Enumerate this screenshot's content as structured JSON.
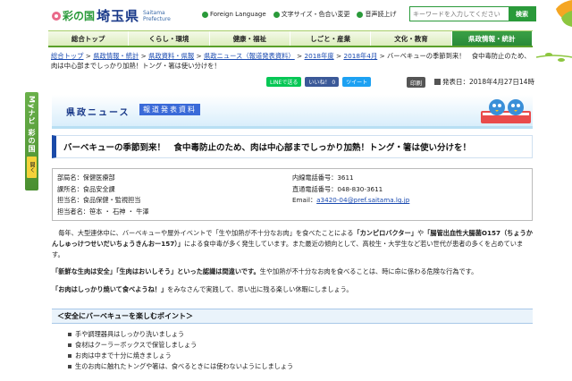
{
  "header": {
    "logo_prefix": "彩の国",
    "logo_main": "埼玉県",
    "logo_sub_1": "Saitama",
    "logo_sub_2": "Prefecture",
    "foreign_language": "Foreign Language",
    "text_size": "文字サイズ・色合い変更",
    "voice": "音声読上げ",
    "search_placeholder": "キーワードを入力してください",
    "search_button": "検索"
  },
  "nav": [
    {
      "label": "総合トップ",
      "active": false
    },
    {
      "label": "くらし・環境",
      "active": false
    },
    {
      "label": "健康・福祉",
      "active": false
    },
    {
      "label": "しごと・産業",
      "active": false
    },
    {
      "label": "文化・教育",
      "active": false
    },
    {
      "label": "県政情報・統計",
      "active": true
    }
  ],
  "side_tab": {
    "label": "Myナビ 彩の国",
    "open_button": "開く"
  },
  "breadcrumb": {
    "links": [
      "総合トップ",
      "県政情報・統計",
      "県政資料・県報",
      "県政ニュース（報道発表資料）",
      "2018年度",
      "2018年4月"
    ],
    "separator": " > ",
    "current": "バーベキューの季節到来！　食中毒防止のため、肉は中心部までしっかり加熱！トング・箸は使い分けを！"
  },
  "share": {
    "line": "LINEで送る",
    "facebook": "いいね！ 0",
    "twitter": "ツイート",
    "print": "印刷",
    "date": "発表日：2018年4月27日14時"
  },
  "banner": {
    "title": "県政ニュース",
    "tag": "報道発表資料"
  },
  "headline": "バーベキューの季節到来！　食中毒防止のため、肉は中心部までしっかり加熱！トング・箸は使い分けを！",
  "info": {
    "dept": "部局名：保健医療部",
    "section": "課所名：食品安全課",
    "person": "担当名：食品保健・監視担当",
    "contacts": "担当者名：笹本 ・ 石神 ・ 牛澤",
    "ext": "内線電話番号：3611",
    "direct": "直通電話番号：048-830-3611",
    "email_label": "Email：",
    "email": "a3420-04@pref.saitama.lg.jp"
  },
  "body": {
    "p1_a": "　毎年、大型連休中に、バーベキューや屋外イベントで「生や加熱が不十分なお肉」を食べたことによる",
    "p1_b": "「カンピロバクター」",
    "p1_c": "や",
    "p1_d": "「腸管出血性大腸菌O157（ちょうかんしゅっけつせいだいちょうきんおー157）」",
    "p1_e": "による食中毒が多く発生しています。また最近の傾向として、高校生・大学生など若い世代が患者の多くを占めています。",
    "p2_a": "「新鮮な生肉は安全」「生肉はおいしそう」といった認識は間違いです。",
    "p2_b": "生や加熱が不十分なお肉を食べることは、時に命に係わる危険な行為です。",
    "p3_a": "「お肉はしっかり焼いて食べようね！」",
    "p3_b": "をみなさんで実践して、思い出に残る楽しい休暇にしましょう。"
  },
  "section_title": "＜安全にバーベキューを楽しむポイント＞",
  "tips": [
    "手や調理器具はしっかり洗いましょう",
    "食材はクーラーボックスで保管しましょう",
    "お肉は中まで十分に焼きましょう",
    "生のお肉に触れたトングや箸は、食べるときには使わないようにしましょう"
  ],
  "colors": {
    "brand_green": "#2a9a3a",
    "nav_active": "#2a8a38",
    "headline_accent": "#1a4aa8",
    "link": "#1a4ab0"
  }
}
